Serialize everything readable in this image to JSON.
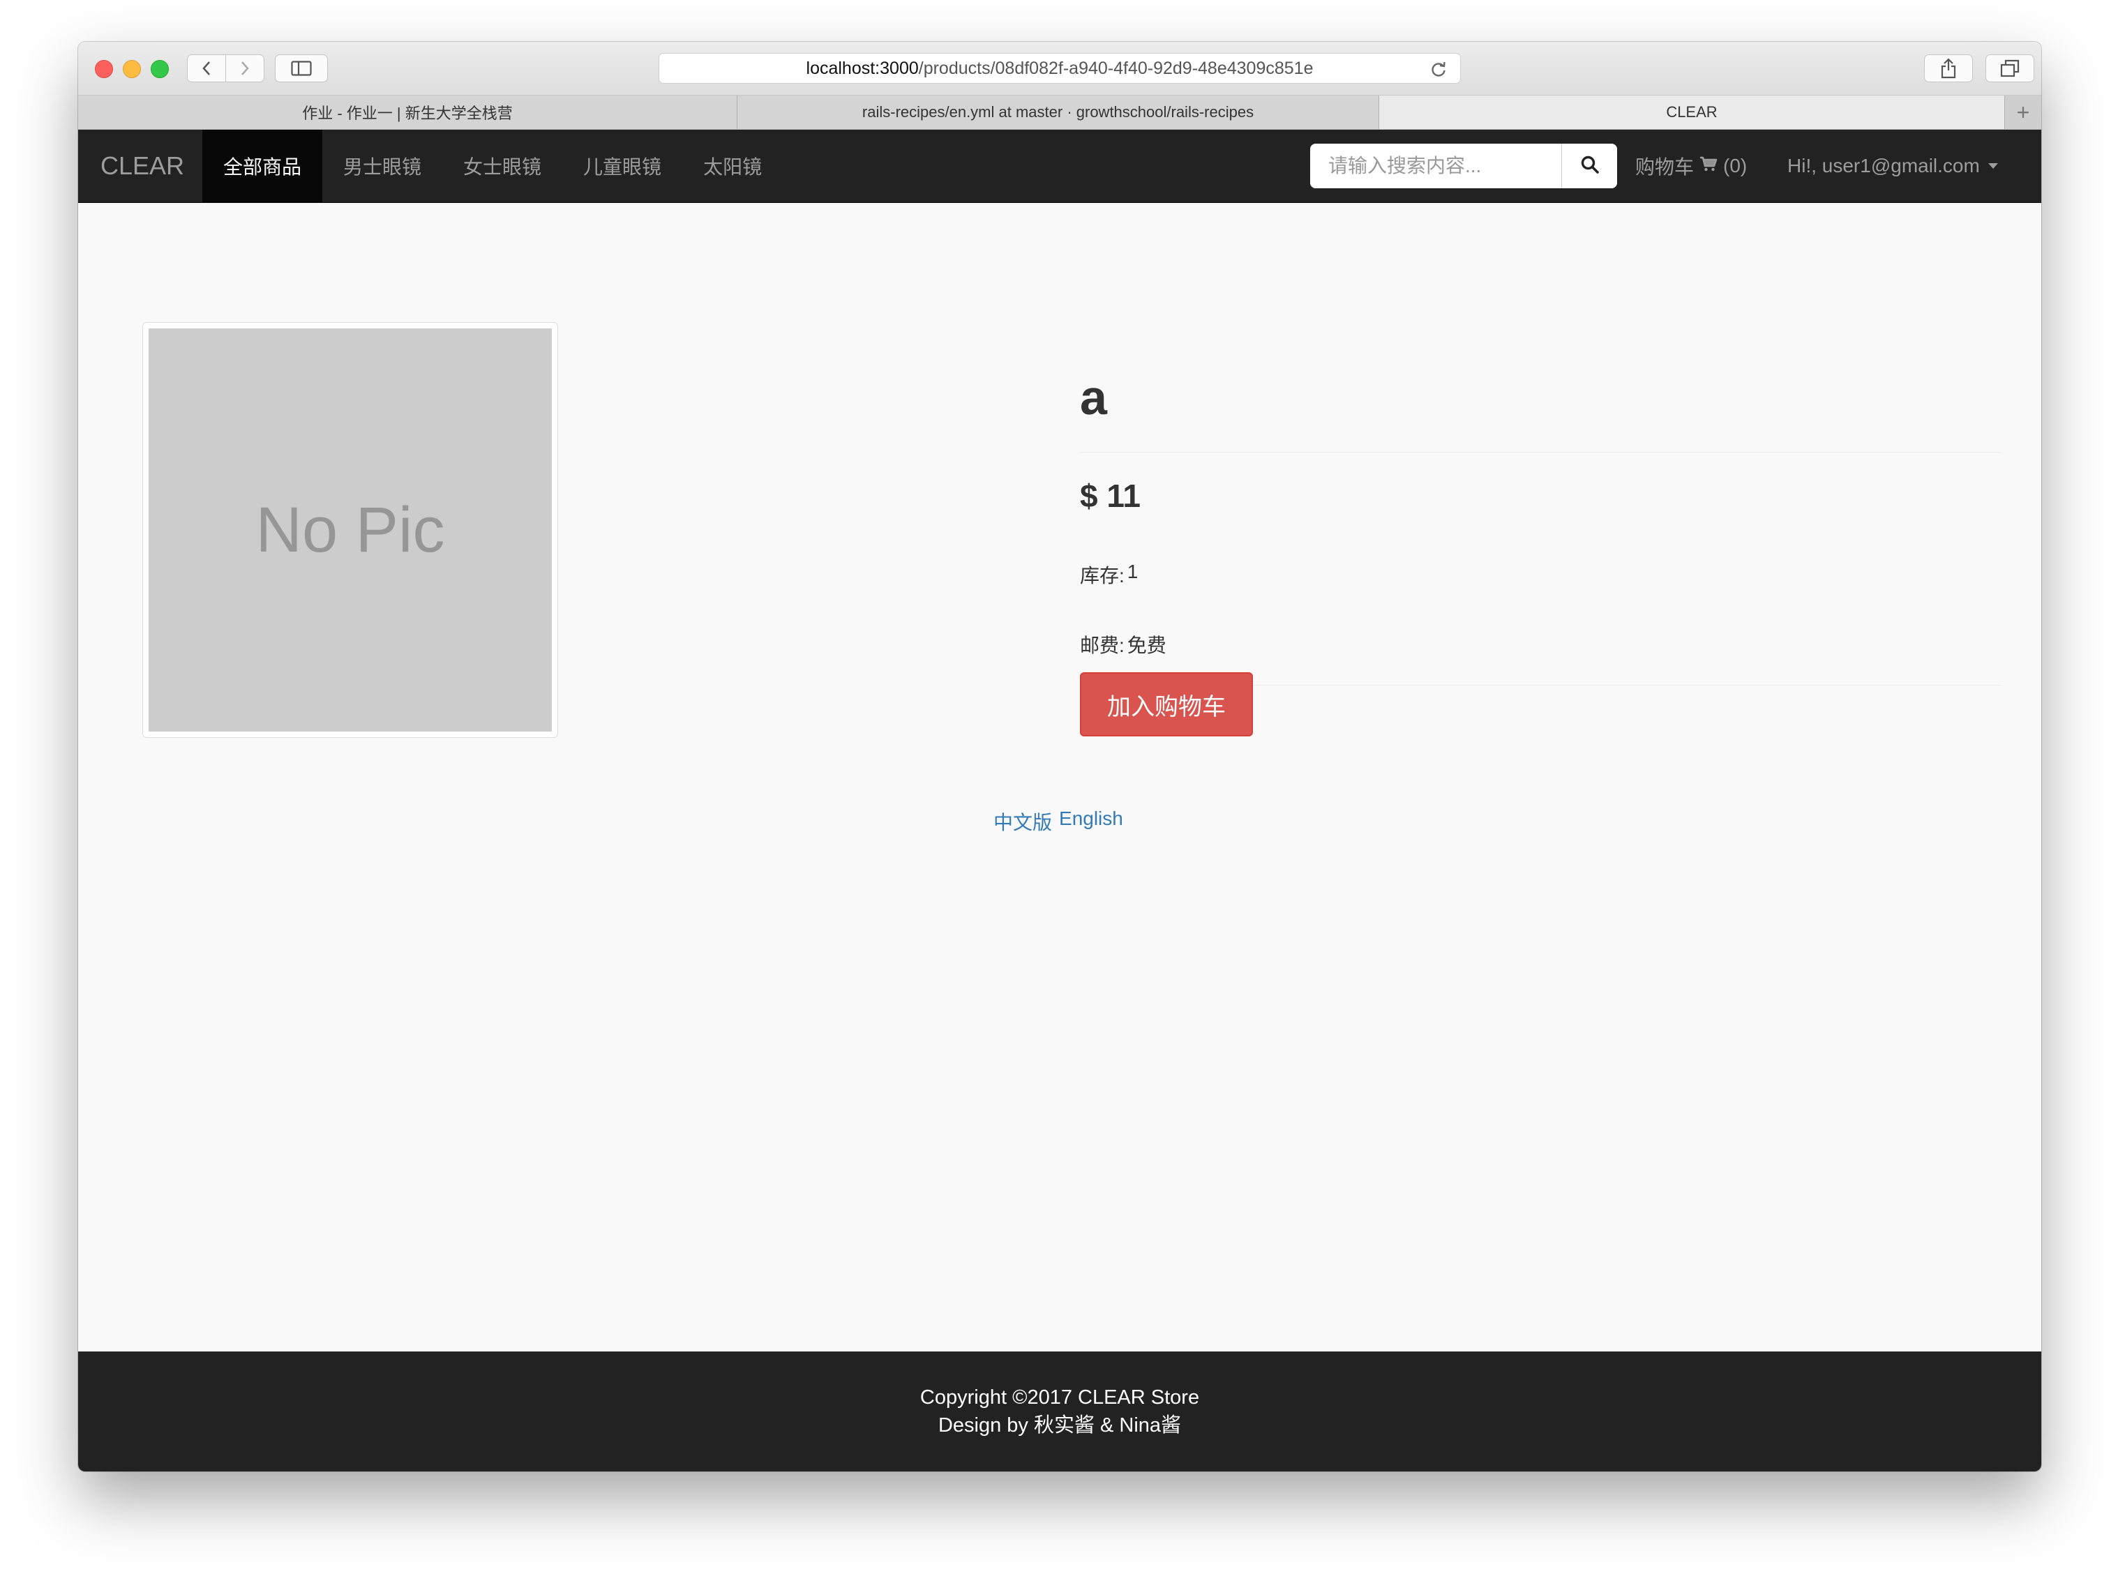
{
  "browser": {
    "url_host": "localhost:3000",
    "url_path": "/products/08df082f-a940-4f40-92d9-48e4309c851e",
    "tabs": [
      {
        "label": "作业 - 作业一 | 新生大学全栈营"
      },
      {
        "label": "rails-recipes/en.yml at master · growthschool/rails-recipes"
      },
      {
        "label": "CLEAR"
      }
    ],
    "new_tab_label": "+"
  },
  "navbar": {
    "brand": "CLEAR",
    "items": [
      {
        "label": "全部商品"
      },
      {
        "label": "男士眼镜"
      },
      {
        "label": "女士眼镜"
      },
      {
        "label": "儿童眼镜"
      },
      {
        "label": "太阳镜"
      }
    ],
    "search": {
      "placeholder": "请输入搜索内容...",
      "value": ""
    },
    "cart": {
      "label": "购物车",
      "count": "(0)"
    },
    "user": {
      "greeting": "Hi!, user1@gmail.com"
    }
  },
  "product": {
    "image_placeholder": "No Pic",
    "title": "a",
    "price": "$ 11",
    "stock_label": "库存:",
    "stock_value": "1",
    "shipping_label": "邮费:",
    "shipping_value": "免费",
    "add_to_cart": "加入购物车"
  },
  "language": {
    "zh": "中文版",
    "en": "English"
  },
  "footer": {
    "copyright": "Copyright ©2017 CLEAR Store",
    "design": "Design by 秋实酱 & Nina酱"
  },
  "colors": {
    "navbar_bg": "#222222",
    "danger": "#d9534f",
    "link": "#337ab7"
  }
}
